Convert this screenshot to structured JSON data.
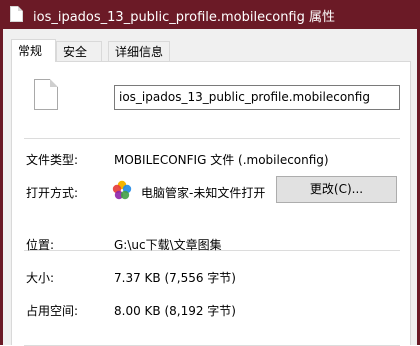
{
  "window": {
    "title": "ios_ipados_13_public_profile.mobileconfig 属性"
  },
  "tabs": [
    {
      "label": "常规",
      "active": true
    },
    {
      "label": "安全",
      "active": false
    },
    {
      "label": "详细信息",
      "active": false
    }
  ],
  "general": {
    "file_name": "ios_ipados_13_public_profile.mobileconfig",
    "file_type_label": "文件类型:",
    "file_type_value": "MOBILECONFIG 文件 (.mobileconfig)",
    "open_with_label": "打开方式:",
    "open_with_value": "电脑管家-未知文件打开",
    "change_button": "更改(C)...",
    "location_label": "位置:",
    "location_value": "G:\\uc下载\\文章图集",
    "size_label": "大小:",
    "size_value": "7.37 KB (7,556 字节)",
    "disk_size_label": "占用空间:",
    "disk_size_value": "8.00 KB (8,192 字节)"
  },
  "icons": {
    "title_icon": "file-icon",
    "file_icon": "file-icon",
    "open_with_icon": "app-icon"
  },
  "colors": {
    "titlebar": "#6b1a26",
    "dialog_bg": "#f0f0f0",
    "button_bg": "#e1e1e1"
  }
}
